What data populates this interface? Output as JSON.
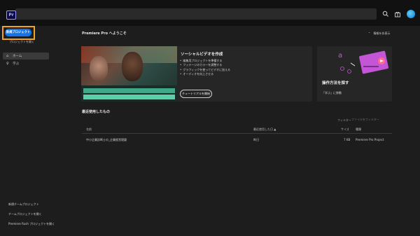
{
  "app": {
    "logo_text": "Pr"
  },
  "topbar": {
    "search_icon": "search-icon",
    "gift_icon": "gift-icon"
  },
  "sidebar": {
    "new_project_label": "新規プロジェクト",
    "open_project_label": "プロジェクトを開く",
    "items": [
      {
        "label": "ホーム",
        "icon": "home-icon",
        "active": true
      },
      {
        "label": "学ぶ",
        "icon": "lightbulb-icon",
        "active": false
      }
    ],
    "bottom": [
      "新規チームプロジェクト",
      "チームプロジェクトを開く",
      "Premiere Rush プロジェクトを開く"
    ]
  },
  "main": {
    "welcome": "Premiere Pro へようこそ",
    "hide_info": "情報を非表示",
    "card": {
      "title": "ソーシャルビデオを作成",
      "bullets": [
        "編集用プロジェクトを準備する",
        "フッテージのカラーを調整する",
        "グラフィックを使ってビデオに加える",
        "オーディオを向上させる"
      ],
      "button": "チュートリアルを開始"
    },
    "card2": {
      "title": "操作方法を探す",
      "link": "「学ぶ」に移動"
    },
    "recent": {
      "title": "最近使用したもの",
      "filter_label": "フィルター",
      "filter_placeholder": "ファイルをフィルター",
      "columns": [
        "名前",
        "最近使用した日 ▲",
        "サイズ",
        "種類"
      ],
      "rows": [
        {
          "name": "中小企業診断士の_企業経営理論",
          "date": "昨日",
          "size": "7 KB",
          "type": "Premiere Pro Project"
        }
      ]
    }
  }
}
